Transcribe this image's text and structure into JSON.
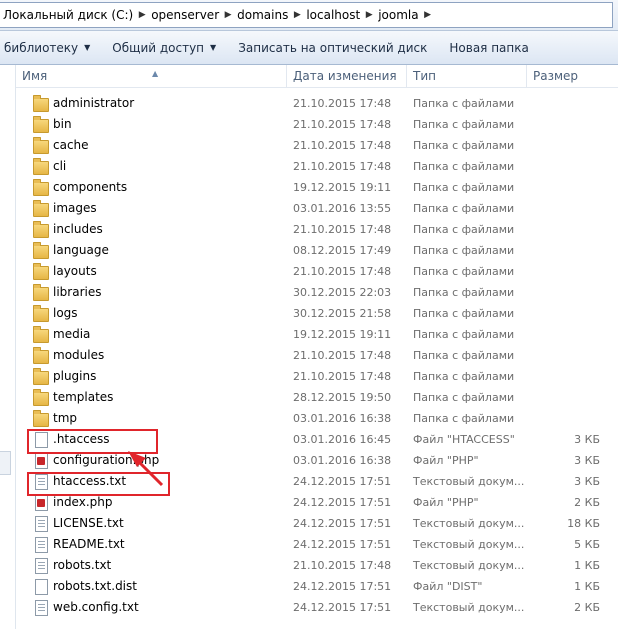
{
  "address_bar": {
    "crumbs": [
      "Локальный диск (C:)",
      "openserver",
      "domains",
      "localhost",
      "joomla"
    ]
  },
  "toolbar": {
    "library_label": "библиотеку",
    "share_label": "Общий доступ",
    "burn_label": "Записать на оптический диск",
    "new_folder_label": "Новая папка"
  },
  "columns": {
    "name": "Имя",
    "date": "Дата изменения",
    "type": "Тип",
    "size": "Размер"
  },
  "files": [
    {
      "name": "administrator",
      "date": "21.10.2015 17:48",
      "type": "Папка с файлами",
      "size": "",
      "icon": "folder-icon"
    },
    {
      "name": "bin",
      "date": "21.10.2015 17:48",
      "type": "Папка с файлами",
      "size": "",
      "icon": "folder-icon"
    },
    {
      "name": "cache",
      "date": "21.10.2015 17:48",
      "type": "Папка с файлами",
      "size": "",
      "icon": "folder-icon"
    },
    {
      "name": "cli",
      "date": "21.10.2015 17:48",
      "type": "Папка с файлами",
      "size": "",
      "icon": "folder-icon"
    },
    {
      "name": "components",
      "date": "19.12.2015 19:11",
      "type": "Папка с файлами",
      "size": "",
      "icon": "folder-icon"
    },
    {
      "name": "images",
      "date": "03.01.2016 13:55",
      "type": "Папка с файлами",
      "size": "",
      "icon": "folder-icon"
    },
    {
      "name": "includes",
      "date": "21.10.2015 17:48",
      "type": "Папка с файлами",
      "size": "",
      "icon": "folder-icon"
    },
    {
      "name": "language",
      "date": "08.12.2015 17:49",
      "type": "Папка с файлами",
      "size": "",
      "icon": "folder-icon"
    },
    {
      "name": "layouts",
      "date": "21.10.2015 17:48",
      "type": "Папка с файлами",
      "size": "",
      "icon": "folder-icon"
    },
    {
      "name": "libraries",
      "date": "30.12.2015 22:03",
      "type": "Папка с файлами",
      "size": "",
      "icon": "folder-icon"
    },
    {
      "name": "logs",
      "date": "30.12.2015 21:58",
      "type": "Папка с файлами",
      "size": "",
      "icon": "folder-icon"
    },
    {
      "name": "media",
      "date": "19.12.2015 19:11",
      "type": "Папка с файлами",
      "size": "",
      "icon": "folder-icon"
    },
    {
      "name": "modules",
      "date": "21.10.2015 17:48",
      "type": "Папка с файлами",
      "size": "",
      "icon": "folder-icon"
    },
    {
      "name": "plugins",
      "date": "21.10.2015 17:48",
      "type": "Папка с файлами",
      "size": "",
      "icon": "folder-icon"
    },
    {
      "name": "templates",
      "date": "28.12.2015 19:50",
      "type": "Папка с файлами",
      "size": "",
      "icon": "folder-icon"
    },
    {
      "name": "tmp",
      "date": "03.01.2016 16:38",
      "type": "Папка с файлами",
      "size": "",
      "icon": "folder-icon"
    },
    {
      "name": ".htaccess",
      "date": "03.01.2016 16:45",
      "type": "Файл \"HTACCESS\"",
      "size": "3 КБ",
      "icon": "file-icon"
    },
    {
      "name": "configuration.php",
      "date": "03.01.2016 16:38",
      "type": "Файл \"PHP\"",
      "size": "3 КБ",
      "icon": "php-file-icon"
    },
    {
      "name": "htaccess.txt",
      "date": "24.12.2015 17:51",
      "type": "Текстовый докум...",
      "size": "3 КБ",
      "icon": "text-file-icon"
    },
    {
      "name": "index.php",
      "date": "24.12.2015 17:51",
      "type": "Файл \"PHP\"",
      "size": "2 КБ",
      "icon": "php-file-icon"
    },
    {
      "name": "LICENSE.txt",
      "date": "24.12.2015 17:51",
      "type": "Текстовый докум...",
      "size": "18 КБ",
      "icon": "text-file-icon"
    },
    {
      "name": "README.txt",
      "date": "24.12.2015 17:51",
      "type": "Текстовый докум...",
      "size": "5 КБ",
      "icon": "text-file-icon"
    },
    {
      "name": "robots.txt",
      "date": "21.10.2015 17:48",
      "type": "Текстовый докум...",
      "size": "1 КБ",
      "icon": "text-file-icon"
    },
    {
      "name": "robots.txt.dist",
      "date": "24.12.2015 17:51",
      "type": "Файл \"DIST\"",
      "size": "1 КБ",
      "icon": "file-icon"
    },
    {
      "name": "web.config.txt",
      "date": "24.12.2015 17:51",
      "type": "Текстовый докум...",
      "size": "2 КБ",
      "icon": "text-file-icon"
    }
  ],
  "annotation_color": "#e0252b"
}
